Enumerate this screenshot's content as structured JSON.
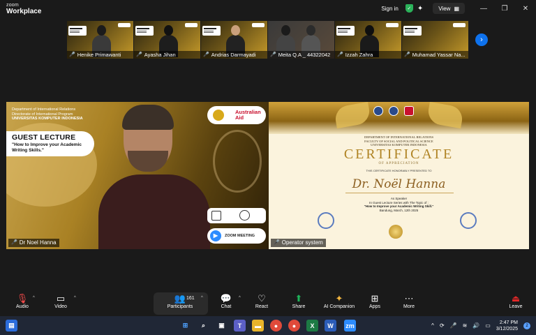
{
  "window": {
    "brand_small": "zoom",
    "brand_large": "Workplace",
    "sign_in": "Sign in",
    "view": "View"
  },
  "participants": [
    {
      "name": "Henike Primawanti"
    },
    {
      "name": "Ayasha Jihan"
    },
    {
      "name": "Andrias Darmayadi"
    },
    {
      "name": "Meita Q.A _ 44322042"
    },
    {
      "name": "Izzah Zahra"
    },
    {
      "name": "Muhamad Yassar Na..."
    }
  ],
  "speaker_tile": {
    "dept_line1": "Department of International Relations",
    "dept_line2": "Directorate of International Program",
    "dept_line3": "UNIVERSITAS KOMPUTER INDONESIA",
    "headline": "GUEST LECTURE",
    "topic": "\"How to Improve your Academic Writing Skills.\"",
    "partner_logo": "Australian Aid",
    "zoom_label": "ZOOM MEETING",
    "name": "Dr Noel Hanna"
  },
  "certificate": {
    "inst1": "DEPARTMENT OF INTERNATIONAL RELATIONS",
    "inst2": "FACULTY OF SOCIAL AND POLITICAL SCIENCE",
    "inst3": "UNIVERSITAS KOMPUTER INDONESIA",
    "title": "CERTIFICATE",
    "subtitle": "OF APPRECIATION",
    "presented": "THIS CERTIFICATE HONORABLY PRESENTED TO",
    "recipient": "Dr. Noël Hanna",
    "role_line1": "As Speaker",
    "role_line2": "In Guest Lecture Series with The Topic of :",
    "role_line3": "\"How to Improve your Academic Writing Skill.\"",
    "role_line4": "Bandung, March, 12th 2025",
    "tile_name": "Operator system"
  },
  "toolbar": {
    "audio": "Audio",
    "video": "Video",
    "participants": "Participants",
    "participants_count": "161",
    "chat": "Chat",
    "react": "React",
    "share": "Share",
    "ai": "AI Companion",
    "apps": "Apps",
    "more": "More",
    "leave": "Leave"
  },
  "taskbar": {
    "time": "2:47 PM",
    "date": "3/12/2025",
    "notif_count": "2"
  },
  "colors": {
    "accent": "#0e72ed",
    "share": "#1fb35a",
    "leave": "#e02828",
    "muted": "#ff4d4d"
  }
}
